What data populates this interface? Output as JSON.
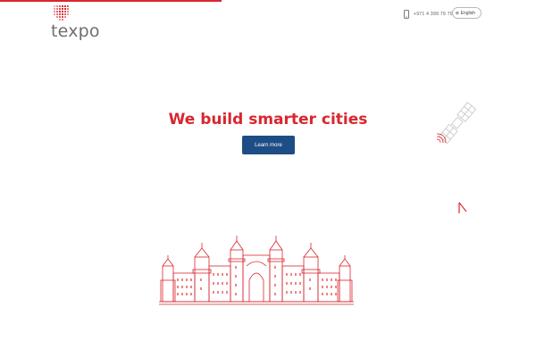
{
  "header": {
    "logo_text": "texpo",
    "phone_number": "+971 4 399 79 70",
    "language_label": "English"
  },
  "hero": {
    "title": "We build smarter cities",
    "cta_label": "Learn more"
  },
  "colors": {
    "brand_red": "#d9262e",
    "cta_blue": "#1e4d86",
    "logo_gray": "#6f6f6f"
  },
  "icons": [
    "phone-icon",
    "globe-icon",
    "satellite-icon",
    "flag-icon"
  ]
}
